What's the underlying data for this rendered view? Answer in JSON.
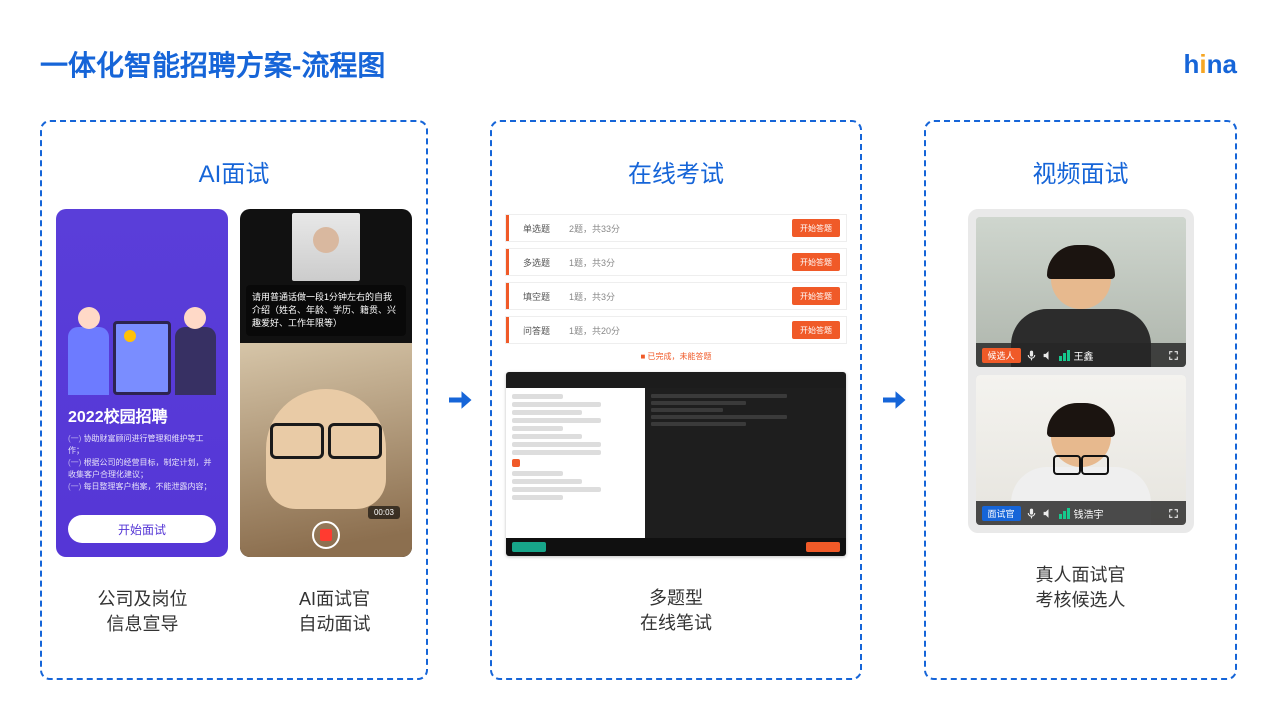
{
  "header": {
    "title": "一体化智能招聘方案-流程图",
    "logo_h": "h",
    "logo_i": "i",
    "logo_na": "na"
  },
  "p1": {
    "title": "AI面试",
    "campus_heading": "2022校园招聘",
    "campus_line1": "协助财富顾问进行管理和维护等工作；",
    "campus_line2": "根据公司的经营目标，制定计划，并收集客户合理化建议；",
    "campus_line3": "每日整理客户档案，不能泄露内容；",
    "start_btn": "开始面试",
    "prompt": "请用普通话做一段1分钟左右的自我介绍（姓名、年龄、学历、籍贯、兴趣爱好、工作年限等）",
    "timer": "00:03",
    "cap1_l1": "公司及岗位",
    "cap1_l2": "信息宣导",
    "cap2_l1": "AI面试官",
    "cap2_l2": "自动面试"
  },
  "p2": {
    "title": "在线考试",
    "rows": [
      {
        "a": "单选题",
        "b": "2题，共33分",
        "c": "开始答题"
      },
      {
        "a": "多选题",
        "b": "1题，共3分",
        "c": "开始答题"
      },
      {
        "a": "填空题",
        "b": "1题，共3分",
        "c": "开始答题"
      },
      {
        "a": "问答题",
        "b": "1题，共20分",
        "c": "开始答题"
      }
    ],
    "note": "■ 已完成，未能答题",
    "cap_l1": "多题型",
    "cap_l2": "在线笔试"
  },
  "p3": {
    "title": "视频面试",
    "cand_tag": "候选人",
    "cand_name": "王鑫",
    "int_tag": "面试官",
    "int_name": "钱浩宇",
    "cap_l1": "真人面试官",
    "cap_l2": "考核候选人"
  }
}
